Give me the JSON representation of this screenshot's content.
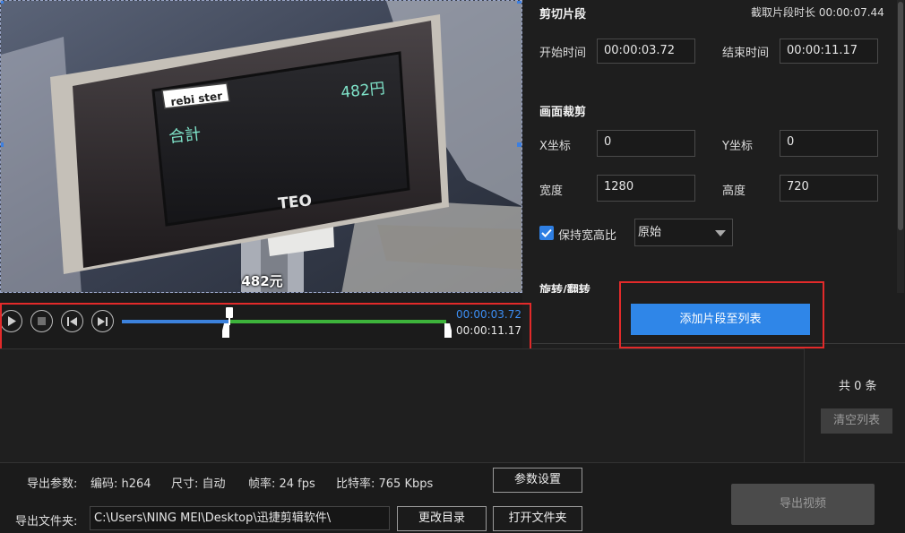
{
  "preview": {
    "subtitle": "482元",
    "scene": {
      "brand": "rebi ster",
      "price_display": "482円",
      "total_label": "合計",
      "stand_logo": "TEO"
    }
  },
  "player": {
    "current_time": "00:00:03.72",
    "end_time": "00:00:11.17",
    "progress": 0.331,
    "clip_start": 0.331,
    "clip_end": 1.0
  },
  "clip": {
    "section_title": "剪切片段",
    "duration_label": "截取片段时长 00:00:07.44",
    "start_label": "开始时间",
    "start_value": "00:00:03.72",
    "end_label": "结束时间",
    "end_value": "00:00:11.17"
  },
  "crop": {
    "section_title": "画面裁剪",
    "x_label": "X坐标",
    "x_value": "0",
    "y_label": "Y坐标",
    "y_value": "0",
    "width_label": "宽度",
    "width_value": "1280",
    "height_label": "高度",
    "height_value": "720",
    "keep_ratio_label": "保持宽高比",
    "keep_ratio_checked": true,
    "ratio_option": "原始"
  },
  "rotate": {
    "section_title": "旋转/翻转"
  },
  "add_button": "添加片段至列表",
  "list": {
    "count": "共 0 条",
    "clear_button": "清空列表"
  },
  "export": {
    "params_label": "导出参数:",
    "codec": "编码:  h264",
    "size": "尺寸:  自动",
    "fps": "帧率:  24 fps",
    "bitrate": "比特率:  765 Kbps",
    "params_button": "参数设置",
    "folder_label": "导出文件夹:",
    "folder_path": "C:\\Users\\NING MEI\\Desktop\\迅捷剪辑软件\\",
    "change_dir_button": "更改目录",
    "open_folder_button": "打开文件夹",
    "export_button": "导出视频"
  },
  "colors": {
    "accent": "#2f86e8",
    "played": "#3c82dd",
    "clip_range": "#3db33b",
    "highlight": "#e22a2a"
  }
}
